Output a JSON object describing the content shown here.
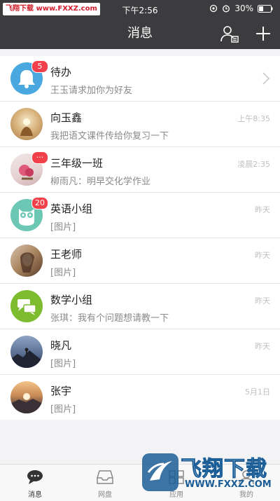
{
  "status": {
    "watermark_part1": "飞翔下载",
    "watermark_part2": "www.FXXZ.com",
    "time": "下午2:56",
    "battery": "30%"
  },
  "header": {
    "title": "消息",
    "contacts_icon": "contacts-icon",
    "add_icon": "plus-icon"
  },
  "conversations": [
    {
      "name": "待办",
      "preview": "王玉请求加你为好友",
      "time": "",
      "badge": "5",
      "avatar": "bell-icon"
    },
    {
      "name": "向玉鑫",
      "preview": "我把语文课件传给你复习一下",
      "time": "上午8:35",
      "badge": "",
      "avatar": "photo"
    },
    {
      "name": "三年级一班",
      "preview": "柳雨凡：明早交化学作业",
      "time": "凌晨2:35",
      "badge": "···",
      "avatar": "photo"
    },
    {
      "name": "英语小组",
      "preview": "[图片]",
      "time": "昨天",
      "badge": "20",
      "avatar": "owl-icon"
    },
    {
      "name": "王老师",
      "preview": "[图片]",
      "time": "昨天",
      "badge": "",
      "avatar": "photo"
    },
    {
      "name": "数学小组",
      "preview": "张琪：我有个问题想请教一下",
      "time": "昨天",
      "badge": "",
      "avatar": "chat-bubbles-icon"
    },
    {
      "name": "晓凡",
      "preview": "[图片]",
      "time": "昨天",
      "badge": "",
      "avatar": "photo"
    },
    {
      "name": "张宇",
      "preview": "[图片]",
      "time": "5月1日",
      "badge": "",
      "avatar": "photo"
    }
  ],
  "tabs": [
    {
      "label": "消息",
      "icon": "chat-icon"
    },
    {
      "label": "网盘",
      "icon": "inbox-icon"
    },
    {
      "label": "应用",
      "icon": "apps-icon"
    },
    {
      "label": "我的",
      "icon": "profile-icon"
    }
  ],
  "logo_watermark": {
    "text": "飞翔下载",
    "url": "WWW.FXXZ.COM"
  },
  "colors": {
    "header_bg": "#3c3c3f",
    "badge": "#f2404a",
    "bell_avatar": "#4aa8e0",
    "owl_avatar": "#6cc7b5",
    "math_avatar": "#7dbb2f"
  }
}
